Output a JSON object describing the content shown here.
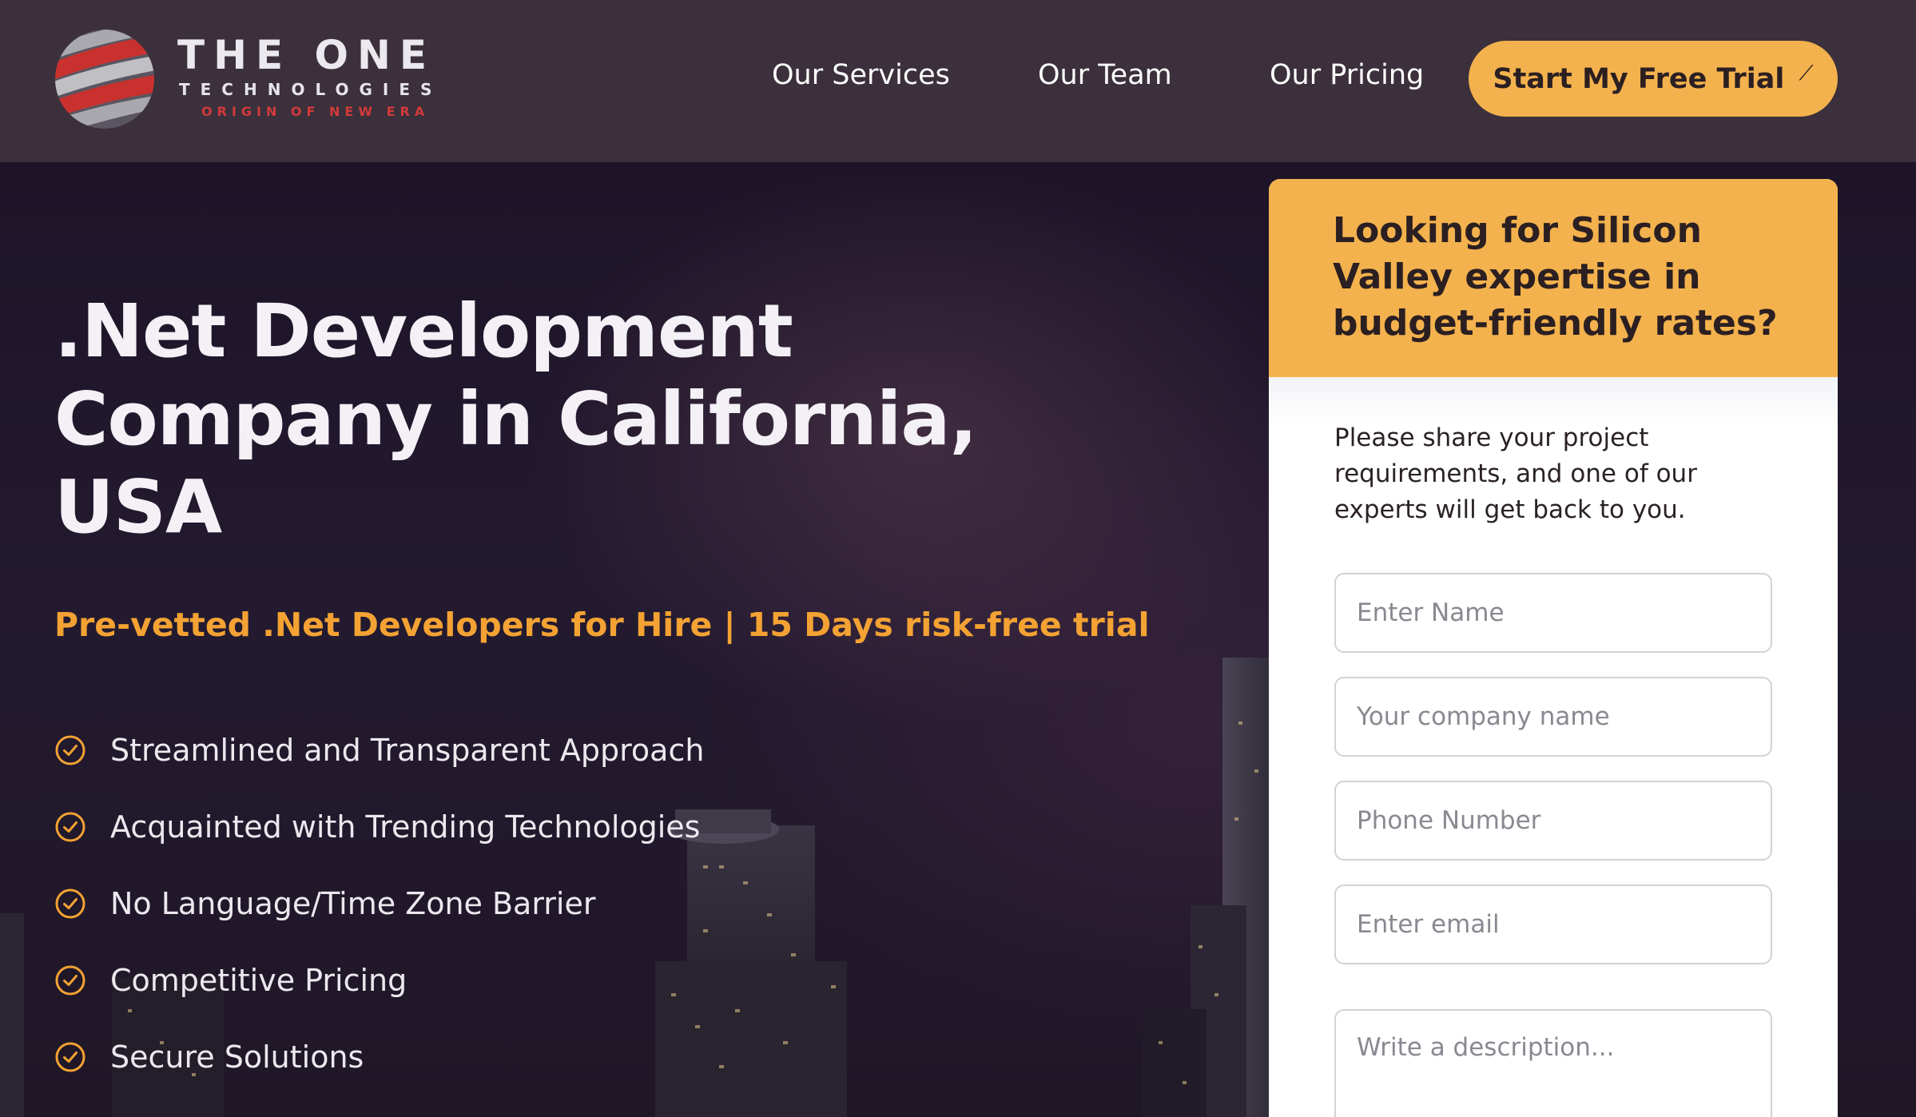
{
  "header": {
    "logo": {
      "title": "THE ONE",
      "subtitle": "TECHNOLOGIES",
      "tagline": "ORIGIN OF NEW ERA"
    },
    "nav": [
      {
        "label": "Our Services"
      },
      {
        "label": "Our Team"
      },
      {
        "label": "Our Pricing"
      }
    ],
    "cta": {
      "label": "Start My Free Trial",
      "icon": "diagonal-arrow-icon"
    }
  },
  "hero": {
    "title": ".Net Development Company in California, USA",
    "subtitle": "Pre-vetted .Net Developers for Hire | 15 Days risk-free trial",
    "features": [
      {
        "label": "Streamlined and Transparent Approach",
        "icon": "check-circle-icon"
      },
      {
        "label": "Acquainted with Trending Technologies",
        "icon": "check-circle-icon"
      },
      {
        "label": "No Language/Time Zone Barrier",
        "icon": "check-circle-icon"
      },
      {
        "label": "Competitive Pricing",
        "icon": "check-circle-icon"
      },
      {
        "label": "Secure Solutions",
        "icon": "check-circle-icon"
      }
    ]
  },
  "form": {
    "heading": "Looking for Silicon Valley expertise in budget-friendly rates?",
    "intro": "Please share your project requirements, and one of our experts will get back to you.",
    "fields": {
      "name": {
        "placeholder": "Enter Name",
        "value": ""
      },
      "company": {
        "placeholder": "Your company name",
        "value": ""
      },
      "phone": {
        "placeholder": "Phone Number",
        "value": ""
      },
      "email": {
        "placeholder": "Enter email",
        "value": ""
      },
      "description": {
        "placeholder": "Write a description...",
        "value": ""
      }
    }
  },
  "colors": {
    "header_bg": "#3b303b",
    "accent": "#f3b24d",
    "subtitle": "#f3a233",
    "logo_red": "#d23a3a"
  }
}
